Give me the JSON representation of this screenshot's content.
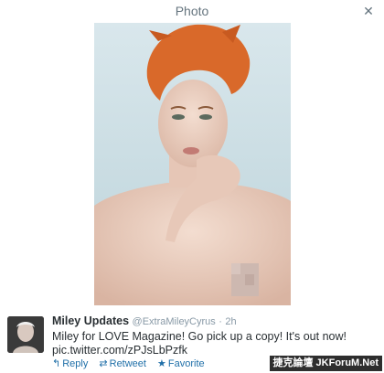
{
  "header": {
    "title": "Photo",
    "close_icon": "close-icon"
  },
  "tweet": {
    "fullname": "Miley Updates",
    "username": "@ExtraMileyCyrus",
    "separator": "·",
    "time": "2h",
    "text_line1": "Miley for LOVE Magazine! Go pick up a copy! It's out now!",
    "text_line2": "pic.twitter.com/zPJsLbPzfk",
    "actions": {
      "reply": {
        "icon": "reply-icon",
        "label": "Reply"
      },
      "retweet": {
        "icon": "retweet-icon",
        "label": "Retweet"
      },
      "favorite": {
        "icon": "star-icon",
        "label": "Favorite"
      }
    }
  },
  "watermark": "捷克論壇 JKForuM.Net",
  "colors": {
    "link": "#1f6fa8",
    "muted": "#8899a6",
    "photo_background": "#cfe0e6",
    "hair": "#d2691e"
  }
}
